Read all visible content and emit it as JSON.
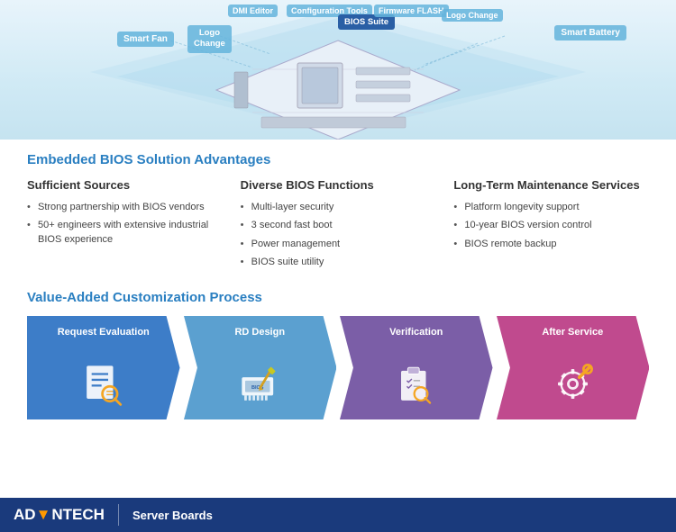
{
  "diagram": {
    "labels": {
      "smart_fan": "Smart Fan",
      "logo_change_left": "Logo\nChange",
      "dmi_editor": "DMI Editor",
      "config_tools": "Configuration Tools",
      "bios_suite": "BIOS Suite",
      "firmware_flash": "Firmware FLASH",
      "logo_change_right": "Logo Change",
      "smart_battery": "Smart Battery"
    }
  },
  "embedded_section": {
    "title": "Embedded BIOS Solution Advantages",
    "columns": [
      {
        "id": "sufficient-sources",
        "title": "Sufficient Sources",
        "items": [
          "Strong partnership with BIOS vendors",
          "50+ engineers with extensive industrial BIOS experience"
        ]
      },
      {
        "id": "diverse-functions",
        "title": "Diverse BIOS Functions",
        "items": [
          "Multi-layer security",
          "3 second fast boot",
          "Power management",
          "BIOS suite utility"
        ]
      },
      {
        "id": "long-term",
        "title": "Long-Term Maintenance Services",
        "items": [
          "Platform longevity support",
          "10-year BIOS version control",
          "BIOS remote backup"
        ]
      }
    ]
  },
  "value_section": {
    "title": "Value-Added Customization Process",
    "steps": [
      {
        "id": "request-evaluation",
        "label": "Request Evaluation",
        "color": "#3d7dc8",
        "icon": "search-doc"
      },
      {
        "id": "rd-design",
        "label": "RD Design",
        "color": "#5ba0d0",
        "icon": "bios-chip"
      },
      {
        "id": "verification",
        "label": "Verification",
        "color": "#7b5ea7",
        "icon": "clipboard-search"
      },
      {
        "id": "after-service",
        "label": "After Service",
        "color": "#c04a8e",
        "icon": "wrench"
      }
    ]
  },
  "footer": {
    "brand": "AD▼NTECH",
    "brand_ad": "AD",
    "brand_van": "▼",
    "brand_tech": "NTECH",
    "subtitle": "Server Boards"
  }
}
